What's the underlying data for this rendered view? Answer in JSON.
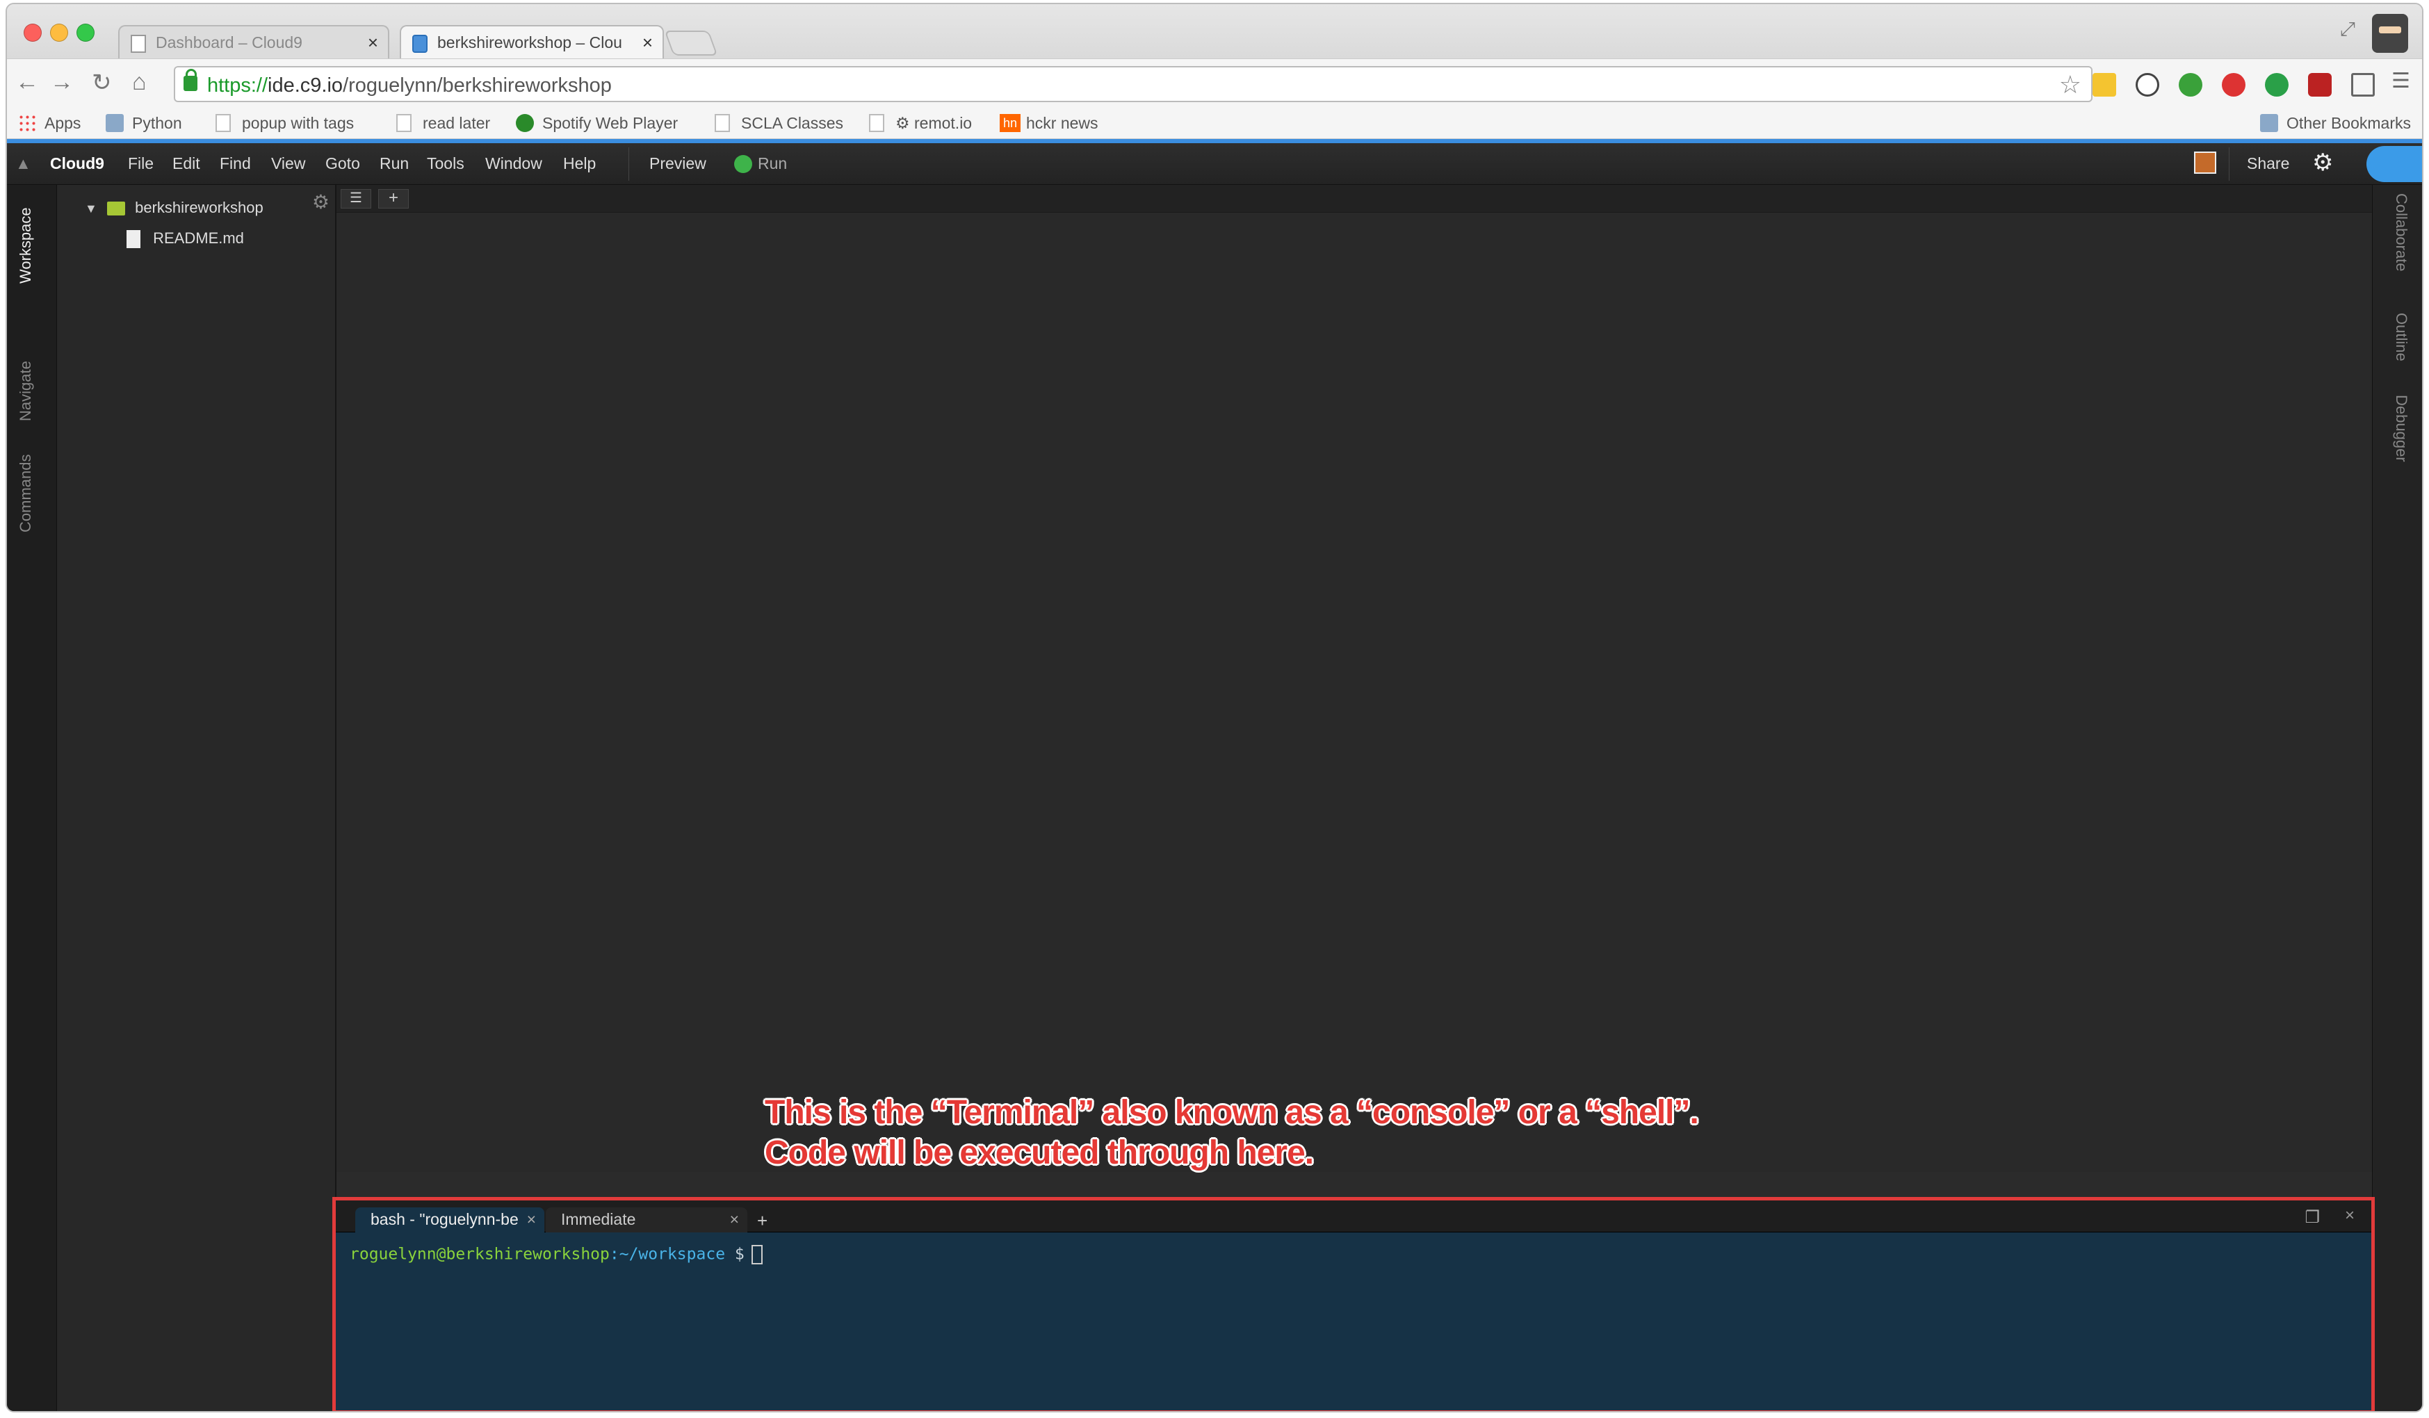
{
  "browser": {
    "tabs": [
      {
        "title": "Dashboard – Cloud9",
        "close": "×"
      },
      {
        "title": "berkshireworkshop – Clou",
        "close": "×"
      }
    ],
    "url_scheme": "https://",
    "url_host": "ide.c9.io",
    "url_path": "/roguelynn/berkshireworkshop",
    "bookmarks": [
      "Apps",
      "Python",
      "popup with tags",
      "read later",
      "Spotify Web Player",
      "SCLA Classes",
      "⚙ remot.io",
      "hckr news"
    ],
    "hn_badge": "hn",
    "other_bookmarks": "Other Bookmarks",
    "traffic_colors": [
      "#fc605c",
      "#fdbc40",
      "#34c84a"
    ],
    "accent": "#3b8ee0"
  },
  "ide": {
    "brand": "Cloud9",
    "menu": [
      "File",
      "Edit",
      "Find",
      "View",
      "Goto",
      "Run",
      "Tools",
      "Window",
      "Help"
    ],
    "preview": "Preview",
    "run": "Run",
    "share": "Share",
    "left_tabs": [
      "Workspace",
      "Navigate",
      "Commands"
    ],
    "right_tabs": [
      "Collaborate",
      "Outline",
      "Debugger"
    ],
    "tree": {
      "root": "berkshireworkshop",
      "files": [
        "README.md"
      ]
    },
    "editor_add": "+"
  },
  "console": {
    "tabs": [
      {
        "title": "bash - \"roguelynn-be",
        "close": "×"
      },
      {
        "title": "Immediate",
        "close": "×"
      }
    ],
    "add": "+",
    "close": "×",
    "prompt_user": "roguelynn@berkshireworkshop",
    "prompt_path": ":~/workspace",
    "prompt_symbol": " $",
    "highlight_color": "#e23b3b"
  },
  "annotation": {
    "line1": "This is the “Terminal” also known as a “console” or a “shell”.",
    "line2": "Code will be executed through here."
  }
}
